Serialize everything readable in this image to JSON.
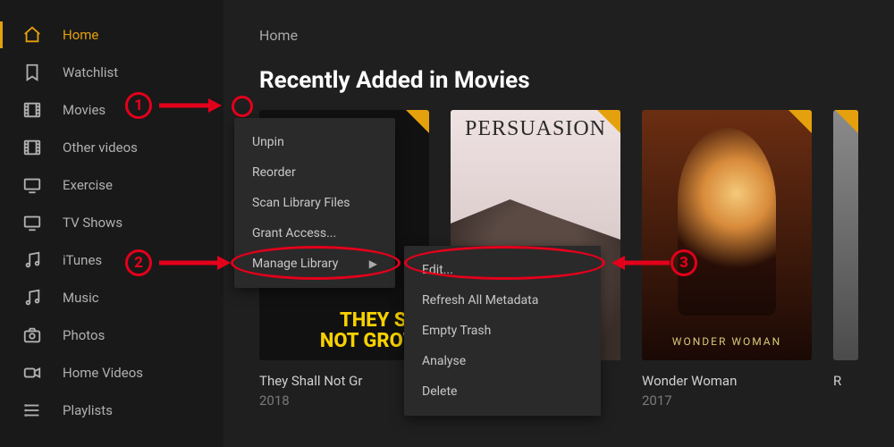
{
  "sidebar": {
    "items": [
      {
        "label": "Home",
        "icon": "home-icon",
        "active": true
      },
      {
        "label": "Watchlist",
        "icon": "bookmark-icon"
      },
      {
        "label": "Movies",
        "icon": "film-icon"
      },
      {
        "label": "Other videos",
        "icon": "film-icon"
      },
      {
        "label": "Exercise",
        "icon": "tv-icon"
      },
      {
        "label": "TV Shows",
        "icon": "tv-icon"
      },
      {
        "label": "iTunes",
        "icon": "music-icon"
      },
      {
        "label": "Music",
        "icon": "music-icon"
      },
      {
        "label": "Photos",
        "icon": "camera-icon"
      },
      {
        "label": "Home Videos",
        "icon": "camcorder-icon"
      },
      {
        "label": "Playlists",
        "icon": "playlist-icon"
      }
    ]
  },
  "main": {
    "breadcrumb": "Home",
    "section_title": "Recently Added in Movies",
    "posters": [
      {
        "title": "They Shall Not Gr",
        "year": "2018",
        "art_label": "THEY SH\nNOT GROW"
      },
      {
        "title": "",
        "year": "",
        "art_label": "PERSUASION"
      },
      {
        "title": "Wonder Woman",
        "year": "2017",
        "art_label": "WONDER   WOMAN"
      },
      {
        "title": "R",
        "year": ""
      }
    ]
  },
  "context_menu": {
    "items": [
      {
        "label": "Unpin"
      },
      {
        "label": "Reorder"
      },
      {
        "label": "Scan Library Files"
      },
      {
        "label": "Grant Access..."
      },
      {
        "label": "Manage Library",
        "has_submenu": true
      }
    ],
    "submenu": [
      {
        "label": "Edit..."
      },
      {
        "label": "Refresh All Metadata"
      },
      {
        "label": "Empty Trash"
      },
      {
        "label": "Analyse"
      },
      {
        "label": "Delete"
      }
    ]
  },
  "annotations": {
    "step1": "1",
    "step2": "2",
    "step3": "3"
  }
}
